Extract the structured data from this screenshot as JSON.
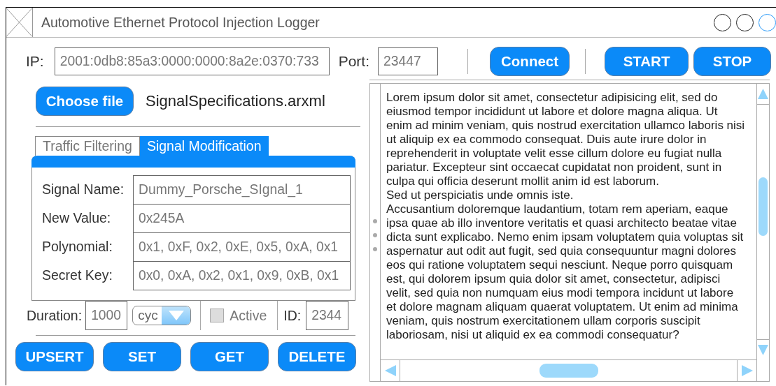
{
  "window": {
    "title": "Automotive Ethernet Protocol Injection Logger"
  },
  "connection": {
    "ip_label": "IP:",
    "ip": "2001:0db8:85a3:0000:0000:8a2e:0370:733",
    "port_label": "Port:",
    "port": "23447",
    "buttons": [
      "Connect",
      "START",
      "STOP"
    ]
  },
  "file": {
    "button": "Choose file",
    "name": "SignalSpecifications.arxml"
  },
  "tabs": [
    {
      "label": "Traffic Filtering",
      "selected": false
    },
    {
      "label": "Signal Modification",
      "selected": true
    }
  ],
  "form": [
    {
      "label": "Signal Name:",
      "value": "Dummy_Porsche_SIgnal_1"
    },
    {
      "label": "New Value:",
      "value": "0x245A"
    },
    {
      "label": "Polynomial:",
      "value": "0x1, 0xF, 0x2, 0xE, 0x5, 0xA, 0x1"
    },
    {
      "label": "Secret Key:",
      "value": "0x0, 0xA, 0x2, 0x1, 0x9, 0xB, 0x1"
    }
  ],
  "options": {
    "duration_label": "Duration:",
    "duration": "1000",
    "unit": "cyc",
    "active_label": "Active",
    "active": false,
    "id_label": "ID:",
    "id": "2344"
  },
  "actions": [
    "UPSERT",
    "SET",
    "GET",
    "DELETE"
  ],
  "log": {
    "paragraphs": [
      "Lorem ipsum dolor sit amet, consectetur adipisicing elit, sed do eiusmod tempor incididunt ut labore et dolore magna aliqua. Ut enim ad minim veniam, quis nostrud exercitation ullamco laboris nisi ut aliquip ex ea commodo consequat. Duis aute irure dolor in reprehenderit in voluptate velit esse cillum dolore eu fugiat nulla pariatur. Excepteur sint occaecat cupidatat non proident, sunt in culpa qui officia deserunt mollit anim id est laborum.",
      "Sed ut perspiciatis unde omnis iste.",
      "Accusantium doloremque laudantium, totam rem aperiam, eaque ipsa quae ab illo inventore veritatis et quasi architecto beatae vitae dicta sunt explicabo. Nemo enim ipsam voluptatem quia voluptas sit aspernatur aut odit aut fugit, sed quia consequuntur magni dolores eos qui ratione voluptatem sequi nesciunt. Neque porro quisquam est, qui dolorem ipsum quia dolor sit amet, consectetur, adipisci velit, sed quia non numquam eius modi tempora incidunt ut labore et dolore magnam aliquam quaerat voluptatem. Ut enim ad minima veniam, quis nostrum exercitationem ullam corporis suscipit laboriosam, nisi ut aliquid ex ea commodi consequatur?"
    ]
  }
}
